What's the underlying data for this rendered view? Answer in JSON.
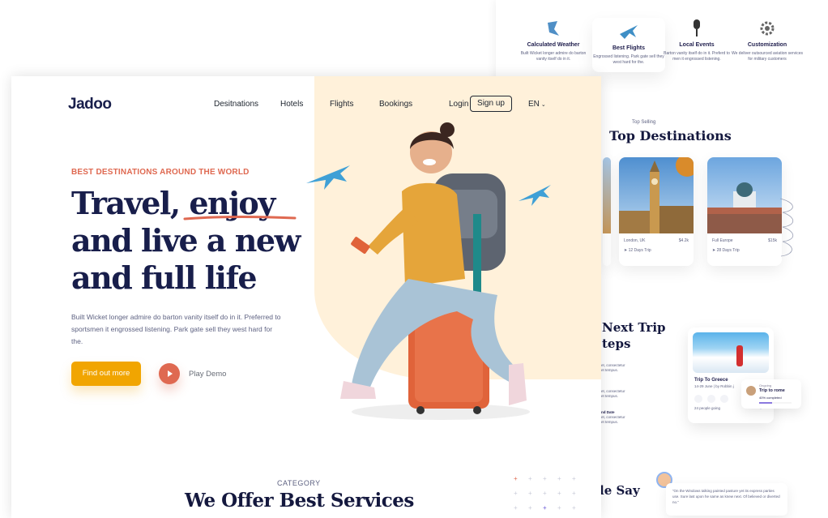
{
  "services": [
    {
      "title": "Calculated Weather",
      "desc": "Built Wicket longer admire do barton vanity itself do in it.",
      "icon": "weather-icon"
    },
    {
      "title": "Best Flights",
      "desc": "Engrossed listening. Park gate sell they west hard for the.",
      "icon": "plane-icon"
    },
    {
      "title": "Local Events",
      "desc": "Barton vanity itself do in it. Preferd to men it engrossed listening.",
      "icon": "microphone-icon"
    },
    {
      "title": "Customization",
      "desc": "We deliver outsourced aviation services for military customers",
      "icon": "gear-icon"
    }
  ],
  "top_selling": {
    "kicker": "Top Selling",
    "title": "Top Destinations"
  },
  "destinations": [
    {
      "place": "London, UK",
      "price": "$4.2k",
      "trip": "12 Days Trip"
    },
    {
      "place": "Full Europe",
      "price": "$15k",
      "trip": "28 Days Trip"
    }
  ],
  "next_trip": {
    "line1": "Next Trip",
    "line2": "teps",
    "sub1": "et, consectetur",
    "sub2": "et tempus.",
    "sub3": "et, consectetur",
    "sub4": "et tempus.",
    "sub5": "nd Date",
    "sub6": "et, consectetur",
    "sub7": "et tempus."
  },
  "trip_card": {
    "title": "Trip To Greece",
    "meta": "14-29 June | by Robbin j",
    "going": "24 people going"
  },
  "ongoing": {
    "label": "Ongoing",
    "title": "Trip to rome",
    "progress": "40% completed",
    "progress_value": 0.4
  },
  "testimonials": {
    "heading": "le Say",
    "quote": "“On the Windows talking painted pasture yet its express parties use. Sure last upon he same as knew next. Of believed or diverted no.”"
  },
  "nav": {
    "logo": "Jadoo",
    "items": [
      "Desitnations",
      "Hotels",
      "Flights",
      "Bookings"
    ],
    "login": "Login",
    "signup": "Sign up",
    "lang": "EN"
  },
  "hero": {
    "kicker": "BEST DESTINATIONS AROUND THE WORLD",
    "title_l1a": "Travel, ",
    "title_l1b": "enjoy",
    "title_l2": "and live a new",
    "title_l3": "and full life",
    "lead": "Built Wicket longer admire do barton vanity itself do in it. Preferred to sportsmen it engrossed listening. Park gate sell they west hard for the.",
    "cta": "Find out more",
    "play": "Play Demo"
  },
  "category": {
    "kicker": "CATEGORY",
    "title": "We Offer Best Services"
  },
  "colors": {
    "accent": "#df6951",
    "cta": "#f1a501",
    "heading": "#181e4b",
    "blob": "#fff1da"
  }
}
